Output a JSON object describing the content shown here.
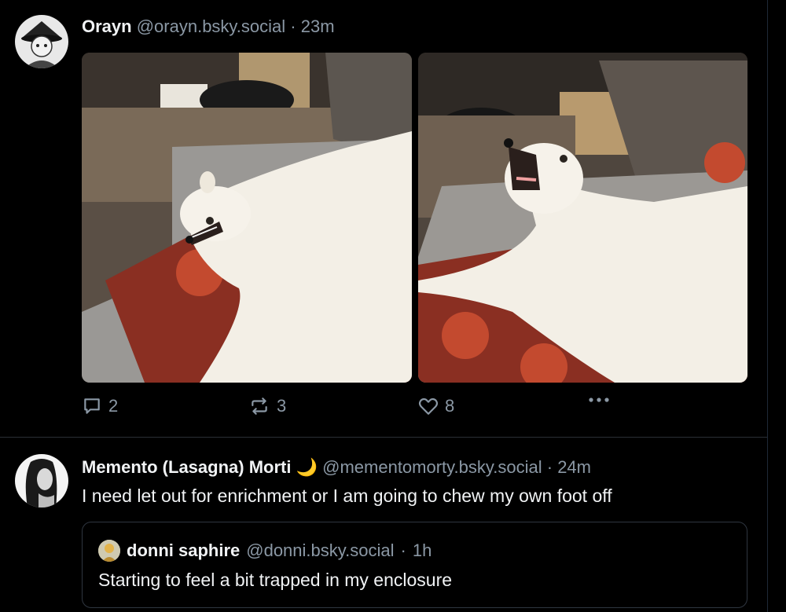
{
  "post1": {
    "display_name": "Orayn",
    "handle": "@orayn.bsky.social",
    "separator": "·",
    "time": "23m",
    "actions": {
      "reply_count": "2",
      "repost_count": "3",
      "like_count": "8"
    },
    "icons": [
      "reply-icon",
      "repost-icon",
      "like-icon",
      "more-icon"
    ]
  },
  "post2": {
    "display_name": "Memento (Lasagna) Morti",
    "name_emoji": "🌙",
    "handle": "@mementomorty.bsky.social",
    "separator": "·",
    "time": "24m",
    "text": "I need let out for enrichment or I am going to chew my own foot off",
    "quote": {
      "display_name": "donni saphire",
      "handle": "@donni.bsky.social",
      "separator": "·",
      "time": "1h",
      "text": "Starting to feel a bit trapped in my enclosure"
    }
  },
  "colors": {
    "background": "#000000",
    "text": "#f1f3f5",
    "muted": "#8b98a5",
    "border": "#2f3640"
  }
}
